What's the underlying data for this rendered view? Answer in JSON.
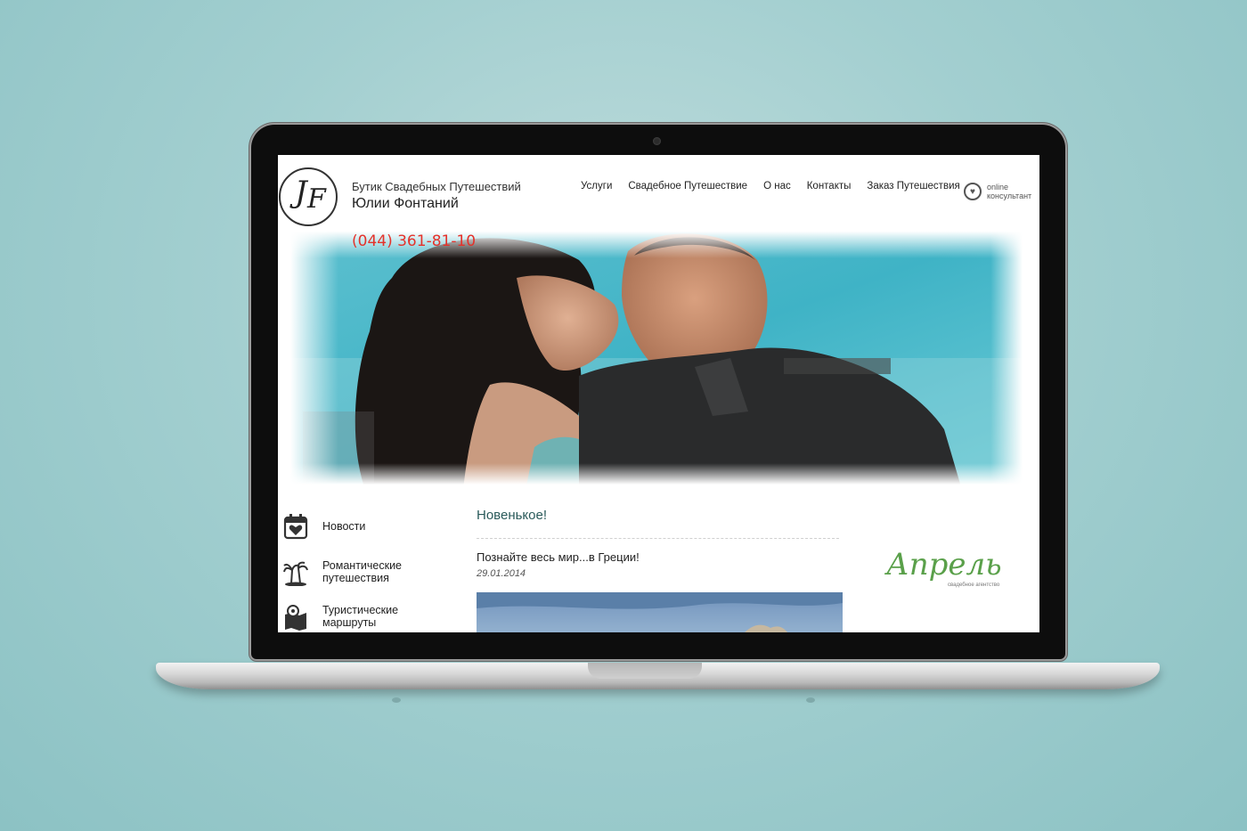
{
  "brand": {
    "logo_text": "JF",
    "line1": "Бутик Свадебных Путешествий",
    "line2": "Юлии Фонтаний",
    "phone": "(044) 361-81-10"
  },
  "nav": [
    {
      "label": "Услуги"
    },
    {
      "label": "Свадебное Путешествие"
    },
    {
      "label": "О нас"
    },
    {
      "label": "Контакты"
    },
    {
      "label": "Заказ Путешествия"
    }
  ],
  "online_consultant": {
    "line1": "online",
    "line2": "консультант"
  },
  "sidebar": [
    {
      "label": "Новости",
      "icon": "calendar-heart-icon"
    },
    {
      "label": "Романтические\nпутешествия",
      "icon": "palm-island-icon"
    },
    {
      "label": "Туристические\nмаршруты",
      "icon": "map-pin-icon"
    }
  ],
  "news": {
    "section_title": "Новенькое!",
    "post_title": "Познайте весь мир...в Греции!",
    "post_date": "29.01.2014"
  },
  "partner_logo": {
    "word": "Апрель",
    "subtitle": "свадебное агентство"
  },
  "colors": {
    "phone": "#e4322b",
    "accent": "#2a5a5a",
    "background": "#a3cfd0"
  }
}
